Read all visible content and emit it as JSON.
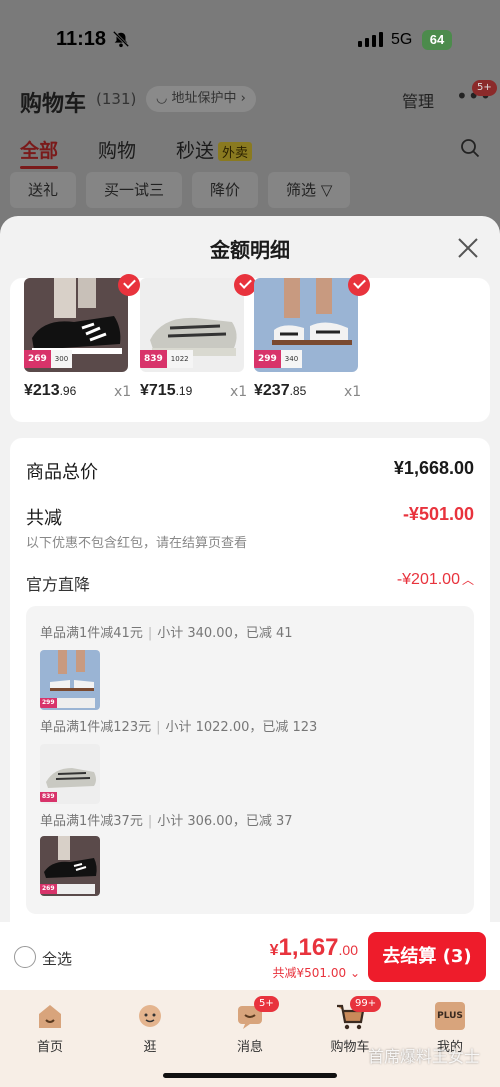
{
  "status": {
    "time": "11:18",
    "network": "5G",
    "battery": "64"
  },
  "header": {
    "title": "购物车",
    "count": "(131)",
    "address": "地址保护中",
    "manage": "管理",
    "more_badge": "5+"
  },
  "tabs": [
    {
      "label": "全部",
      "active": true
    },
    {
      "label": "购物"
    },
    {
      "label": "秒送",
      "tag": "外卖"
    }
  ],
  "filters": [
    "送礼",
    "买一试三",
    "降价",
    "筛选"
  ],
  "sheet": {
    "title": "金额明细",
    "products": [
      {
        "price_int": "¥213",
        "price_dec": ".96",
        "qty": "x1",
        "tag1": "269",
        "tag2": "300"
      },
      {
        "price_int": "¥715",
        "price_dec": ".19",
        "qty": "x1",
        "tag1": "839",
        "tag2": "1022"
      },
      {
        "price_int": "¥237",
        "price_dec": ".85",
        "qty": "x1",
        "tag1": "299",
        "tag2": "340"
      }
    ],
    "goods_total_label": "商品总价",
    "goods_total_value": "¥1,668.00",
    "discount_label": "共减",
    "discount_value": "-¥501.00",
    "note": "以下优惠不包含红包，请在结算页查看",
    "direct_label": "官方直降",
    "direct_value": "-¥201.00",
    "rules": [
      {
        "rule": "单品满1件减41元",
        "detail": "小计 340.00，已减 41"
      },
      {
        "rule": "单品满1件减123元",
        "detail": "小计 1022.00，已减 123"
      },
      {
        "rule": "单品满1件减37元",
        "detail": "小计 306.00，已减 37"
      }
    ]
  },
  "bottom": {
    "select_all": "全选",
    "currency": "¥",
    "total_int": "1,167",
    "total_dec": ".00",
    "saved": "共减¥501.00",
    "checkout": "去结算 (3)"
  },
  "nav": [
    {
      "label": "首页"
    },
    {
      "label": "逛"
    },
    {
      "label": "消息",
      "badge": "5+"
    },
    {
      "label": "购物车",
      "badge": "99+"
    },
    {
      "label": "我的",
      "icon_text": "PLUS"
    }
  ],
  "watermark": "首席爆料王女士",
  "colors": {
    "accent": "#e8333d",
    "checkout": "#ee1c2b",
    "tag_pink": "#d8336a"
  }
}
